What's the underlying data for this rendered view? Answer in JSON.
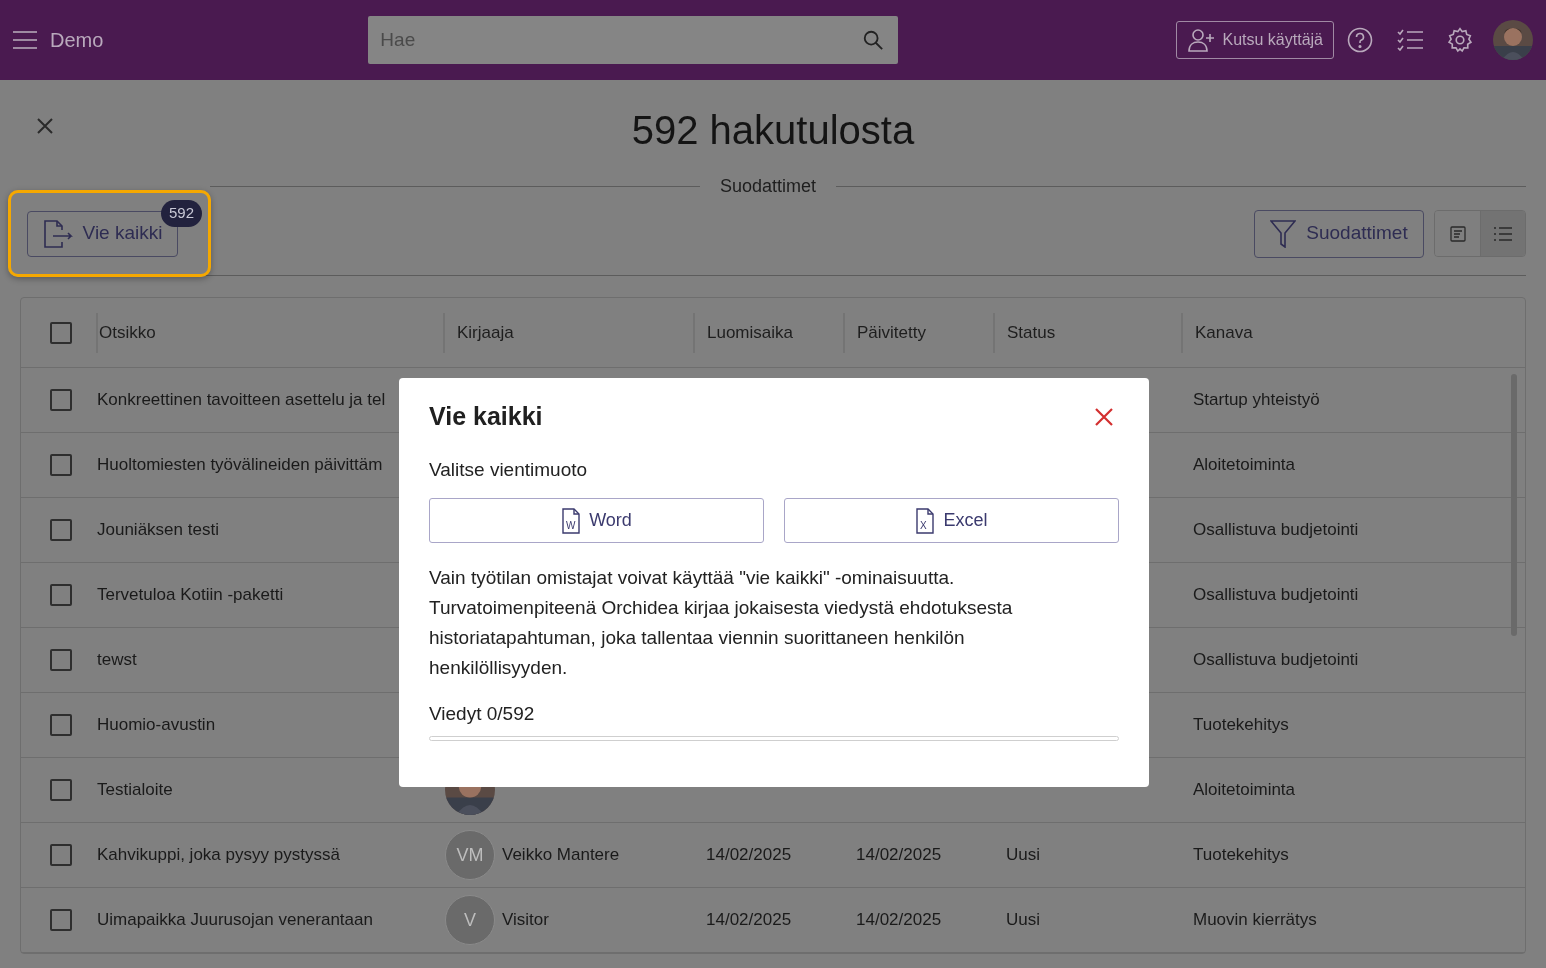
{
  "topbar": {
    "brand": "Demo",
    "search": {
      "placeholder": "Hae"
    },
    "invite_button": "Kutsu käyttäjä"
  },
  "results_title": "592 hakutulosta",
  "filters_divider": "Suodattimet",
  "export_button": {
    "label": "Vie kaikki",
    "badge": "592",
    "highlighted": true
  },
  "filter_button": "Suodattimet",
  "view_toggle": [
    {
      "kind": "card",
      "selected": false
    },
    {
      "kind": "list",
      "selected": true
    }
  ],
  "table": {
    "select_all": {
      "checked": false
    },
    "columns": [
      "Otsikko",
      "Kirjaaja",
      "Luomisaika",
      "Päivitetty",
      "Status",
      "Kanava"
    ],
    "rows": [
      {
        "checked": false,
        "title": "Konkreettinen tavoitteen asettelu ja tel",
        "channel": "Startup yhteistyö"
      },
      {
        "checked": false,
        "title": "Huoltomiesten työvälineiden päivittäm",
        "channel": "Aloitetoiminta"
      },
      {
        "checked": false,
        "title": "Jouniäksen testi",
        "channel": "Osallistuva budjetointi"
      },
      {
        "checked": false,
        "title": "Tervetuloa Kotiin -paketti",
        "channel": "Osallistuva budjetointi"
      },
      {
        "checked": false,
        "title": "tewst",
        "channel": "Osallistuva budjetointi"
      },
      {
        "checked": false,
        "title": "Huomio-avustin",
        "channel": "Tuotekehitys"
      },
      {
        "checked": false,
        "title": "Testialoite",
        "channel": "Aloitetoiminta"
      },
      {
        "checked": false,
        "title": "Kahvikuppi, joka pysyy pystyssä",
        "avatar": {
          "kind": "initials",
          "text": "VM"
        },
        "author": "Veikko Mantere",
        "created": "14/02/2025",
        "updated": "14/02/2025",
        "status": "Uusi",
        "channel": "Tuotekehitys"
      },
      {
        "checked": false,
        "title": "Uimapaikka Juurusojan venerantaan",
        "avatar": {
          "kind": "initials",
          "text": "V"
        },
        "author": "Visitor",
        "created": "14/02/2025",
        "updated": "14/02/2025",
        "status": "Uusi",
        "channel": "Muovin kierrätys"
      }
    ]
  },
  "dialog": {
    "title": "Vie kaikki",
    "prompt": "Valitse vientimuoto",
    "formats": [
      {
        "label": "Word",
        "letter": "W"
      },
      {
        "label": "Excel",
        "letter": "X"
      }
    ],
    "notice": "Vain työtilan omistajat voivat käyttää \"vie kaikki\" -ominaisuutta. Turvatoimenpiteenä Orchidea kirjaa jokaisesta viedystä ehdotuksesta historiatapahtuman, joka tallentaa viennin suorittaneen henkilön henkilöllisyyden.",
    "progress": {
      "label": "Viedyt 0/592",
      "level": 0
    }
  }
}
